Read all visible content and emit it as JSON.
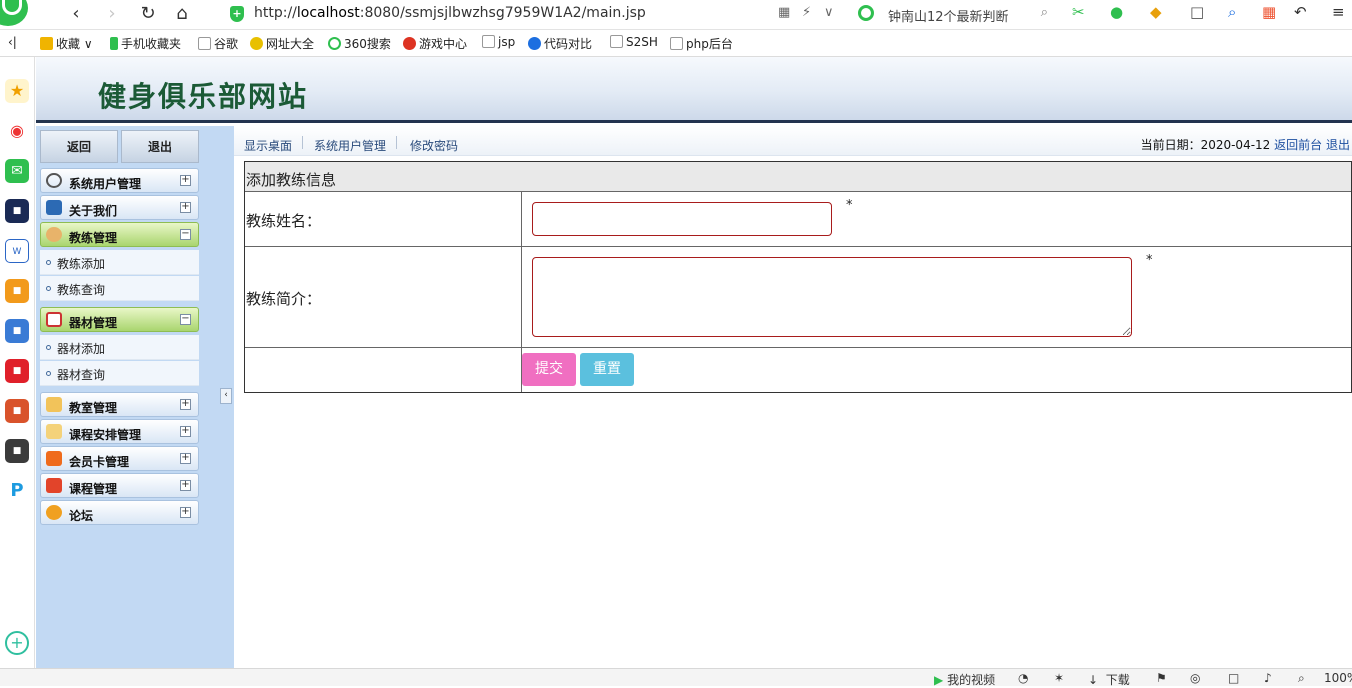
{
  "browser": {
    "url_host": "localhost",
    "url_prefix": "http://",
    "url_rest": ":8080/ssmjsjlbwzhsg7959W1A2/main.jsp",
    "search_text": "钟南山12个最新判断",
    "bookmarks": [
      "收藏",
      "手机收藏夹",
      "谷歌",
      "网址大全",
      "360搜索",
      "游戏中心",
      "jsp",
      "代码对比",
      "S2SH",
      "php后台"
    ],
    "status_items": [
      "我的视频",
      "下载",
      "100%"
    ]
  },
  "site": {
    "title": "健身俱乐部网站"
  },
  "top_buttons": {
    "back": "返回",
    "exit": "退出"
  },
  "menu": [
    {
      "label": "系统用户管理",
      "icon": "gear-icon",
      "open": false
    },
    {
      "label": "关于我们",
      "icon": "monitor-icon",
      "open": false
    },
    {
      "label": "教练管理",
      "icon": "user-icon",
      "open": true,
      "items": [
        "教练添加",
        "教练查询"
      ]
    },
    {
      "label": "器材管理",
      "icon": "table-icon",
      "open": true,
      "items": [
        "器材添加",
        "器材查询"
      ]
    },
    {
      "label": "教室管理",
      "icon": "folder-icon",
      "open": false
    },
    {
      "label": "课程安排管理",
      "icon": "calendar-icon",
      "open": false
    },
    {
      "label": "会员卡管理",
      "icon": "card-icon",
      "open": false
    },
    {
      "label": "课程管理",
      "icon": "course-icon",
      "open": false
    },
    {
      "label": "论坛",
      "icon": "forum-icon",
      "open": false
    }
  ],
  "breadcrumbs": [
    "显示桌面",
    "系统用户管理",
    "修改密码"
  ],
  "date_area": {
    "label": "当前日期：2020-04-12",
    "front_link": "返回前台",
    "logout_link": "退出"
  },
  "form": {
    "title": "添加教练信息",
    "name_label": "教练姓名：",
    "name_value": "",
    "intro_label": "教练简介：",
    "intro_value": "",
    "required_mark": "*",
    "submit_label": "提交",
    "reset_label": "重置"
  },
  "colors": {
    "site_title": "#1b5a36",
    "submit_button": "#f06fc1",
    "reset_button": "#5bc0de",
    "input_border": "#a81c1c",
    "sidebar_bg": "#c2d9f3"
  }
}
